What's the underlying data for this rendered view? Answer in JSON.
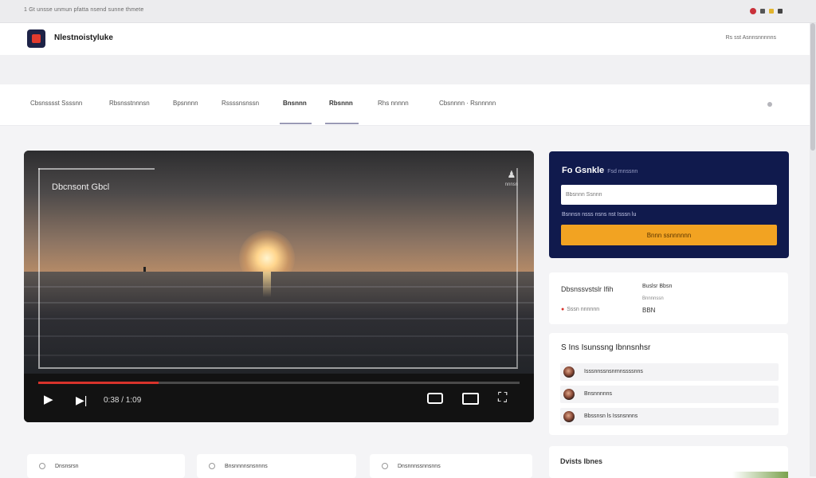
{
  "top_strip": {
    "text": "1 Gt unsse unmun pfatta nsend sunne thmete"
  },
  "header": {
    "brand": "Nlestnoistyluke",
    "right_link": "Rs sst Asnnsnnnnns"
  },
  "nav": {
    "tabs": [
      {
        "label": "Cbsnsssst Ssssnn"
      },
      {
        "label": "Rbsnsstnnnsn"
      },
      {
        "label": "Bpsnnnn"
      },
      {
        "label": "Rssssnsnssn"
      },
      {
        "label": "Bnsnnn"
      },
      {
        "label": "Rbsnnn"
      },
      {
        "label": "Rhs nnnnn"
      },
      {
        "label": "Cbsnnnn · Rsnnnnn"
      }
    ]
  },
  "player": {
    "title": "Dbcnsont Gbcl",
    "logo_text": "nnnsn",
    "time": "0:38 / 1:09",
    "progress": 0.25
  },
  "signup": {
    "title": "Fo Gsnkle",
    "subtitle": "Fsd mnssnn",
    "placeholder": "Bbsnnn Ssnnn",
    "hint": "Bsnnsn nsss nsns nst Isssn lu",
    "button": "Bnnn ssnnnnnn"
  },
  "stats": {
    "left_label": "Dbsnssvstslr Ifih",
    "left_sub": "Sssn nnnnnn",
    "right_label": "Buslsr Bbsn",
    "right_sub": "Bnnnnssn",
    "right_value": "BBN"
  },
  "related": {
    "title": "S Ins Isunssng Ibnnsnhsr",
    "items": [
      {
        "label": "Isssnnssnsnrnnssssnns"
      },
      {
        "label": "Bnsnnnnns"
      },
      {
        "label": "Bbssnsn ls Issnsnnns"
      }
    ]
  },
  "credits": {
    "title": "Dvists Ibnes"
  },
  "info_cards": [
    {
      "label": "Dnsnsrsn"
    },
    {
      "label": "Bnsnnnnsnsnnns"
    },
    {
      "label": "Dnsnnnssnnsnns"
    }
  ]
}
